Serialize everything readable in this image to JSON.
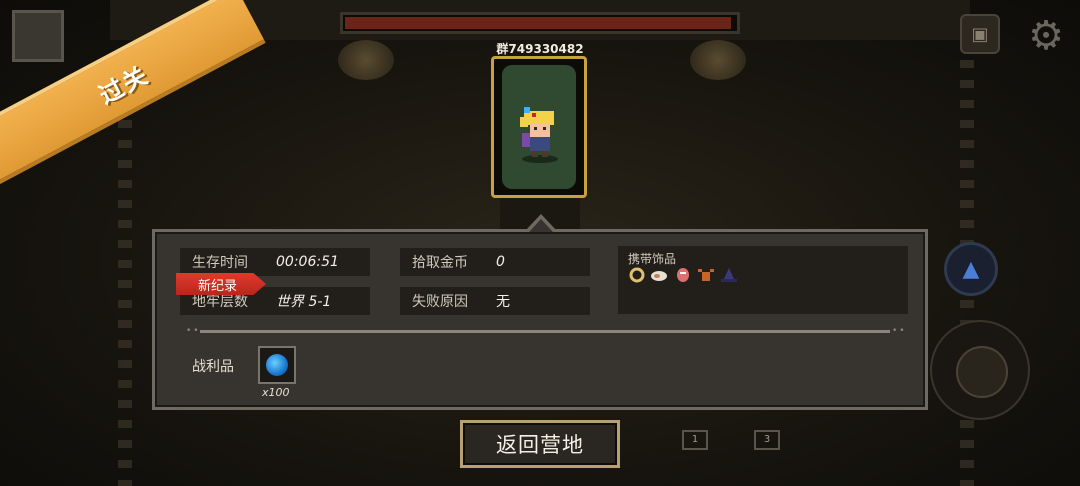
{
  "banner": {
    "text": "过关"
  },
  "player": {
    "group_id": "群749330482"
  },
  "stats": {
    "survival_time_label": "生存时间",
    "survival_time_value": "00:06:51",
    "dungeon_floor_label": "地牢层数",
    "dungeon_floor_value": "世界 5-1",
    "gold_label": "拾取金币",
    "gold_value": "0",
    "fail_reason_label": "失败原因",
    "fail_reason_value": "无",
    "new_record": "新纪录"
  },
  "accessories": {
    "title": "携带饰品",
    "items": [
      "ring-icon",
      "feather-icon",
      "meat-icon",
      "bull-head-icon",
      "witch-hat-icon"
    ]
  },
  "loot": {
    "label": "战利品",
    "item_icon": "blue-gem-icon",
    "count": "x100"
  },
  "hud": {
    "slot_1": "1",
    "slot_3": "3"
  },
  "actions": {
    "return_button": "返回营地"
  },
  "colors": {
    "banner": "#f2b14e",
    "record_tag": "#e03a2c",
    "card_border": "#c8a23a",
    "boss_bar_fill": "#6b2418"
  },
  "boss_health_fraction": 0.99
}
